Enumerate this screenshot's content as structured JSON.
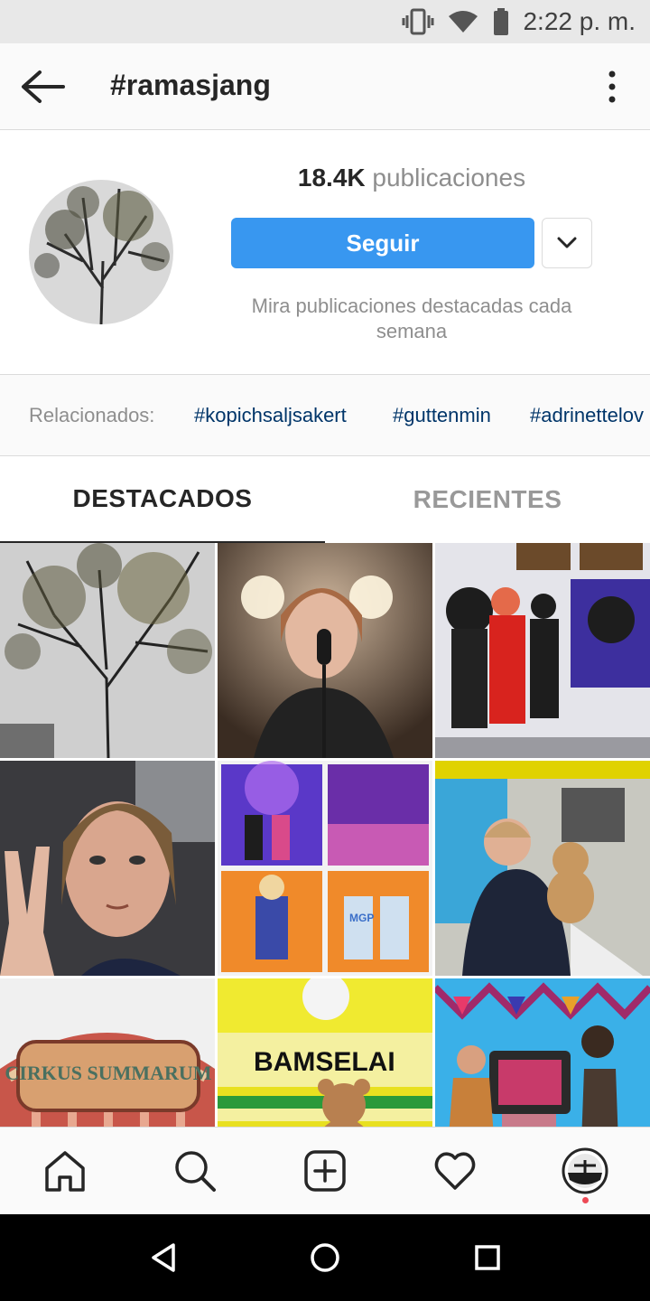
{
  "status_bar": {
    "time": "2:22 p. m.",
    "icons": [
      "vibrate-icon",
      "wifi-icon",
      "battery-icon"
    ]
  },
  "header": {
    "title": "#ramasjang",
    "back_icon": "arrow-left-icon",
    "menu_icon": "more-vertical-icon"
  },
  "profile": {
    "posts_count": "18.4K",
    "posts_label": "publicaciones",
    "follow_label": "Seguir",
    "description": "Mira publicaciones destacadas cada semana"
  },
  "related": {
    "label": "Relacionados:",
    "tags": [
      "#kopichsaljsakert",
      "#guttenmin",
      "#adrinettelov"
    ]
  },
  "tabs": [
    {
      "label": "DESTACADOS",
      "active": true
    },
    {
      "label": "RECIENTES",
      "active": false
    }
  ],
  "grid": [
    {
      "name": "tree-branches-photo"
    },
    {
      "name": "singer-microphone-photo"
    },
    {
      "name": "group-art-gallery-photo"
    },
    {
      "name": "selfie-peace-sign-photo"
    },
    {
      "name": "collage-concert-photo",
      "text": "MGP"
    },
    {
      "name": "man-with-teddy-ambulance-photo"
    },
    {
      "name": "cirkus-summarum-photo",
      "text": "CIRKUS SUMMARUM"
    },
    {
      "name": "bamselance-ambulance-photo",
      "text": "BAMSELAI"
    },
    {
      "name": "tv-show-stage-photo"
    }
  ],
  "bottom_nav": [
    "home-icon",
    "search-icon",
    "add-post-icon",
    "heart-icon",
    "profile-avatar"
  ],
  "system_nav": [
    "back-triangle-icon",
    "home-circle-icon",
    "recents-square-icon"
  ],
  "colors": {
    "accent": "#3897f0",
    "tag": "#003569",
    "muted": "#8e8e8e",
    "notification": "#ed4956"
  }
}
